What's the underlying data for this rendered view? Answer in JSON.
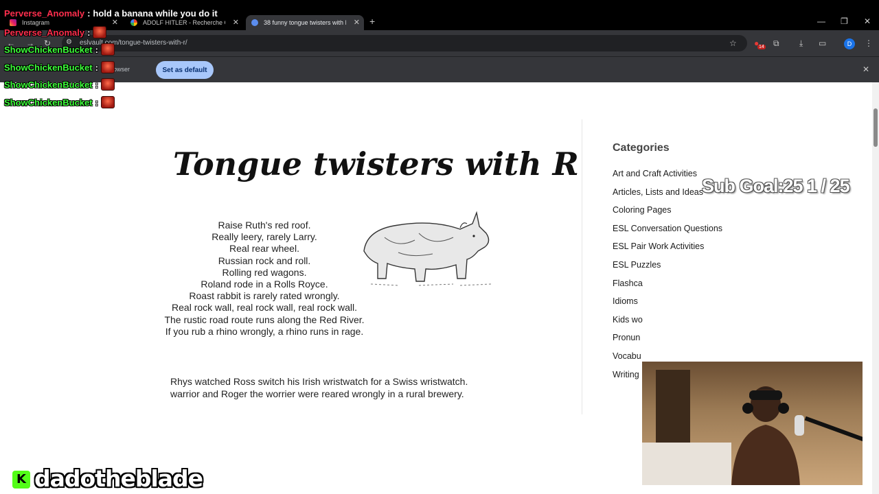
{
  "browser": {
    "tabs": [
      {
        "title": "Instagram",
        "favicon": "instagram-icon"
      },
      {
        "title": "ADOLF HITLER - Recherche Goo",
        "favicon": "google-icon"
      },
      {
        "title": "38 funny tongue twisters with R",
        "favicon": "eslvault-icon",
        "active": true
      }
    ],
    "url": "eslvault.com/tongue-twisters-with-r/",
    "extension_badge": "14",
    "profile_initial": "D",
    "infobar": {
      "text": "lt browser",
      "button_label": "Set as default"
    }
  },
  "page": {
    "title": "Tongue twisters with R",
    "twisters": [
      "Raise Ruth's red roof.",
      "Really leery, rarely Larry.",
      "Real rear wheel.",
      "Russian rock and roll.",
      "Rolling red wagons.",
      "Roland rode in a Rolls Royce.",
      "Roast rabbit is rarely rated wrongly.",
      "Real rock wall, real rock wall, real rock wall.",
      "The rustic road route runs along the Red River.",
      "If you rub a rhino wrongly, a rhino runs in rage."
    ],
    "paragraph_1": "Rhys watched Ross switch his Irish wristwatch for a Swiss wristwatch.",
    "paragraph_2": "warrior and Roger the worrier were reared wrongly in a rural brewery.",
    "sidebar": {
      "heading": "Categories",
      "items": [
        "Art and Craft Activities",
        "Articles, Lists and Ideas",
        "Coloring Pages",
        "ESL Conversation Questions",
        "ESL Pair Work Activities",
        "ESL Puzzles",
        "Flashca",
        "Idioms",
        "Kids wo",
        "Pronun",
        "Vocabu",
        "Writing"
      ]
    }
  },
  "overlay": {
    "chat": [
      {
        "user": "Perverse_Anomaly",
        "message": "hold a banana while you do it",
        "color": "#ff2e4d"
      },
      {
        "user": "Perverse_Anomaly",
        "message": "",
        "emote": true,
        "color": "#ff2e4d"
      },
      {
        "user": "ShowChickenBucket",
        "message": "",
        "emote": true,
        "color": "#3dff3a"
      },
      {
        "user": "ShowChickenBucket",
        "message": "",
        "emote": true,
        "color": "#3dff3a"
      },
      {
        "user": "ShowChickenBucket",
        "message": "",
        "emote": true,
        "color": "#3dff3a"
      },
      {
        "user": "ShowChickenBucket",
        "message": "",
        "emote": true,
        "color": "#3dff3a"
      }
    ],
    "sub_goal": "Sub Goal:25  1 / 25",
    "streamer_name": "dadotheblade",
    "platform_badge": "K"
  }
}
